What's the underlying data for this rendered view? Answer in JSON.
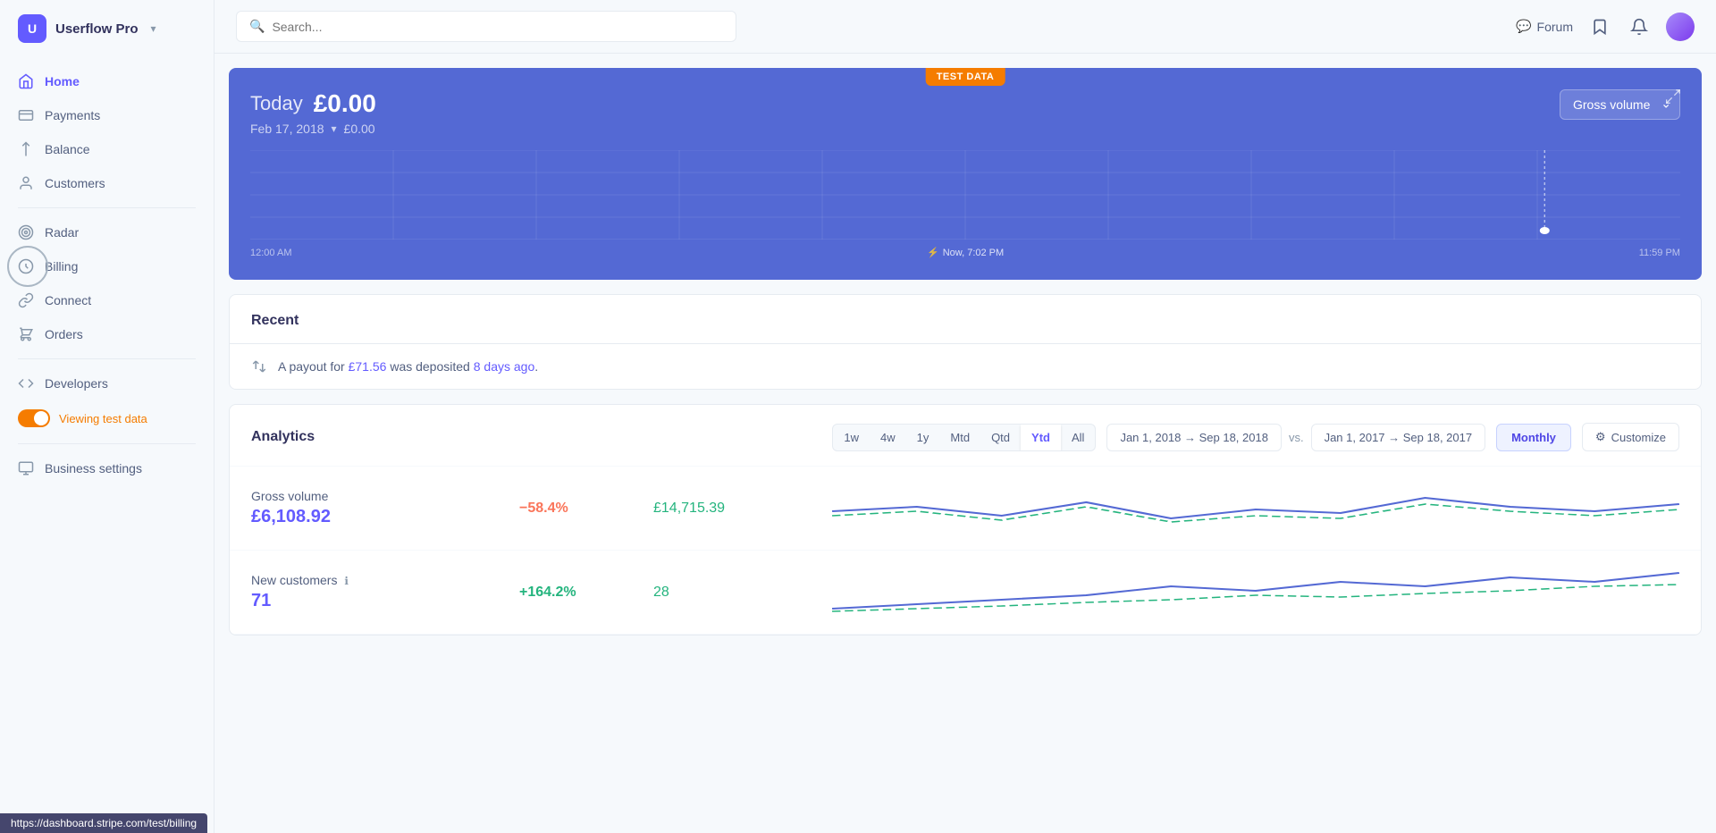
{
  "app": {
    "name": "Userflow Pro",
    "logo_char": "U"
  },
  "header": {
    "search_placeholder": "Search...",
    "forum_label": "Forum"
  },
  "sidebar": {
    "items": [
      {
        "id": "home",
        "label": "Home",
        "icon": "🏠",
        "active": true
      },
      {
        "id": "payments",
        "label": "Payments",
        "icon": "📷"
      },
      {
        "id": "balance",
        "label": "Balance",
        "icon": "⬇"
      },
      {
        "id": "customers",
        "label": "Customers",
        "icon": "👤"
      },
      {
        "id": "radar",
        "label": "Radar",
        "icon": "🔵"
      },
      {
        "id": "billing",
        "label": "Billing",
        "icon": "🔵"
      },
      {
        "id": "connect",
        "label": "Connect",
        "icon": "🔗"
      },
      {
        "id": "orders",
        "label": "Orders",
        "icon": "🗂"
      }
    ],
    "developers_label": "Developers",
    "toggle_label": "Viewing test data",
    "business_settings_label": "Business settings"
  },
  "chart": {
    "test_data_badge": "TEST DATA",
    "today_label": "Today",
    "amount": "£0.00",
    "date": "Feb 17, 2018",
    "date_amount": "£0.00",
    "gross_volume_label": "Gross volume",
    "time_start": "12:00 AM",
    "time_now": "Now, 7:02 PM",
    "time_end": "11:59 PM",
    "expand_icon": "↗"
  },
  "recent": {
    "title": "Recent",
    "payout_text": "A payout for",
    "payout_amount": "£71.56",
    "payout_middle": "was deposited",
    "payout_time": "8 days ago",
    "payout_suffix": "."
  },
  "analytics": {
    "title": "Analytics",
    "period_buttons": [
      {
        "id": "1w",
        "label": "1w"
      },
      {
        "id": "4w",
        "label": "4w"
      },
      {
        "id": "1y",
        "label": "1y"
      },
      {
        "id": "mtd",
        "label": "Mtd"
      },
      {
        "id": "qtd",
        "label": "Qtd"
      },
      {
        "id": "ytd",
        "label": "Ytd",
        "active": true
      },
      {
        "id": "all",
        "label": "All"
      }
    ],
    "date_range_current": "Jan 1, 2018 → Sep 18, 2018",
    "vs_label": "vs.",
    "date_range_previous": "Jan 1, 2017 → Sep 18, 2017",
    "monthly_label": "Monthly",
    "customize_label": "Customize",
    "metrics": [
      {
        "id": "gross-volume",
        "label": "Gross volume",
        "value": "£6,108.92",
        "change": "−58.4%",
        "change_type": "negative",
        "compare_value": "£14,715.39"
      },
      {
        "id": "new-customers",
        "label": "New customers",
        "info": true,
        "value": "71",
        "change": "+164.2%",
        "change_type": "positive",
        "compare_value": "28"
      }
    ]
  },
  "url_bar": "https://dashboard.stripe.com/test/billing"
}
